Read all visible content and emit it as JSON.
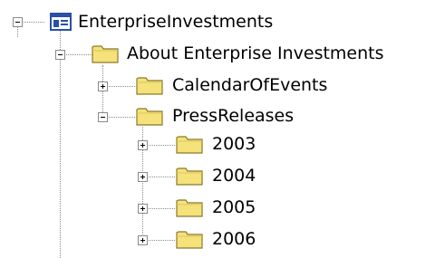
{
  "tree": {
    "root": {
      "label": "EnterpriseInvestments",
      "icon": "site-icon",
      "expanded": true
    },
    "about": {
      "label": "About Enterprise Investments",
      "icon": "folder-icon",
      "expanded": true
    },
    "calendar": {
      "label": "CalendarOfEvents",
      "icon": "folder-icon",
      "expanded": false
    },
    "press": {
      "label": "PressReleases",
      "icon": "folder-icon",
      "expanded": true
    },
    "years": [
      {
        "label": "2003",
        "icon": "folder-icon",
        "expanded": false
      },
      {
        "label": "2004",
        "icon": "folder-icon",
        "expanded": false
      },
      {
        "label": "2005",
        "icon": "folder-icon",
        "expanded": false
      },
      {
        "label": "2006",
        "icon": "folder-icon",
        "expanded": false
      }
    ]
  },
  "colors": {
    "folder_fill": "#f5e27a",
    "folder_outline": "#8a7a2a",
    "connector": "#8a8a8a",
    "site_icon_blue": "#2a4fa8"
  }
}
